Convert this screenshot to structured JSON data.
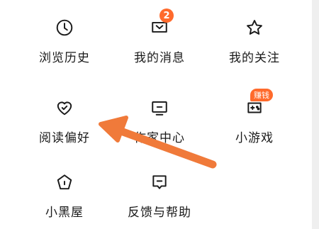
{
  "menu": {
    "row1": [
      {
        "label": "浏览历史",
        "icon": "clock-icon"
      },
      {
        "label": "我的消息",
        "icon": "message-icon",
        "badge": "2"
      },
      {
        "label": "我的关注",
        "icon": "star-icon"
      }
    ],
    "row2": [
      {
        "label": "阅读偏好",
        "icon": "heart-icon"
      },
      {
        "label": "作家中心",
        "icon": "monitor-icon"
      },
      {
        "label": "小游戏",
        "icon": "gamepad-icon",
        "badge": "赚钱"
      }
    ],
    "row3": [
      {
        "label": "小黑屋",
        "icon": "pentagon-icon"
      },
      {
        "label": "反馈与帮助",
        "icon": "feedback-icon"
      }
    ]
  },
  "colors": {
    "accent": "#ff6a2c",
    "arrow": "#f07a3a",
    "text": "#1a1a1a"
  }
}
